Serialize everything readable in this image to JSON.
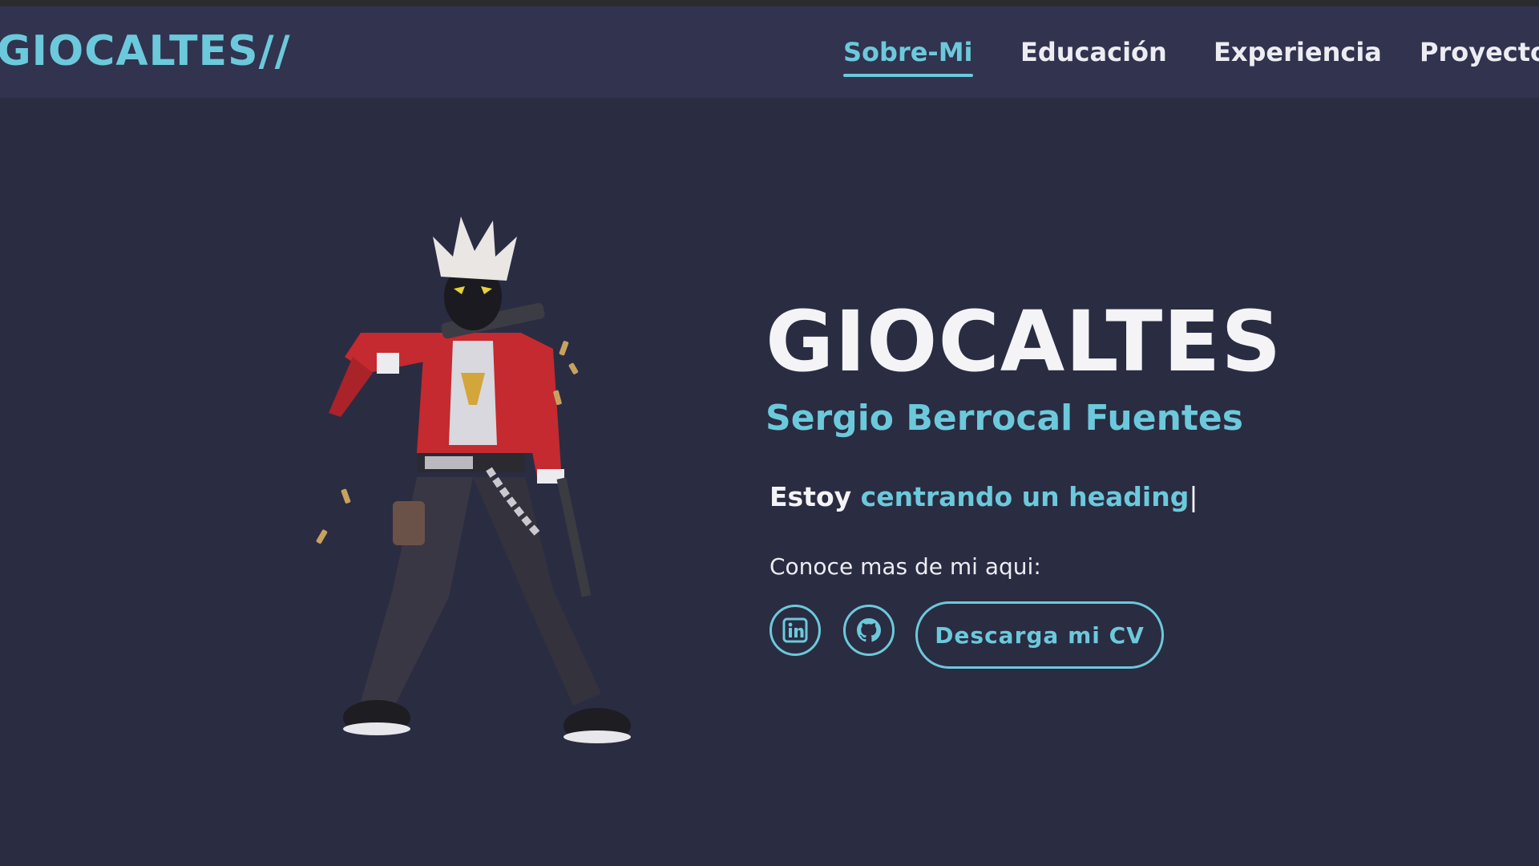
{
  "navbar": {
    "logo": "GIOCALTES//",
    "items": [
      {
        "label": "Sobre-Mi",
        "active": true
      },
      {
        "label": "Educación",
        "active": false
      },
      {
        "label": "Experiencia",
        "active": false
      },
      {
        "label": "Proyectos",
        "active": false
      }
    ]
  },
  "hero": {
    "title": "GIOCALTES",
    "subtitle": "Sergio Berrocal Fuentes",
    "typing_prefix": "Estoy",
    "typing_text": "centrando un heading",
    "cursor": "|",
    "know_more": "Conoce mas de mi aqui:",
    "social": [
      {
        "icon": "linkedin-icon"
      },
      {
        "icon": "github-icon"
      }
    ],
    "cv_button": "Descarga mi CV"
  },
  "colors": {
    "background": "#2a2c42",
    "navbar": "#31334f",
    "accent": "#6cc9db",
    "text": "#f4f4f7"
  }
}
